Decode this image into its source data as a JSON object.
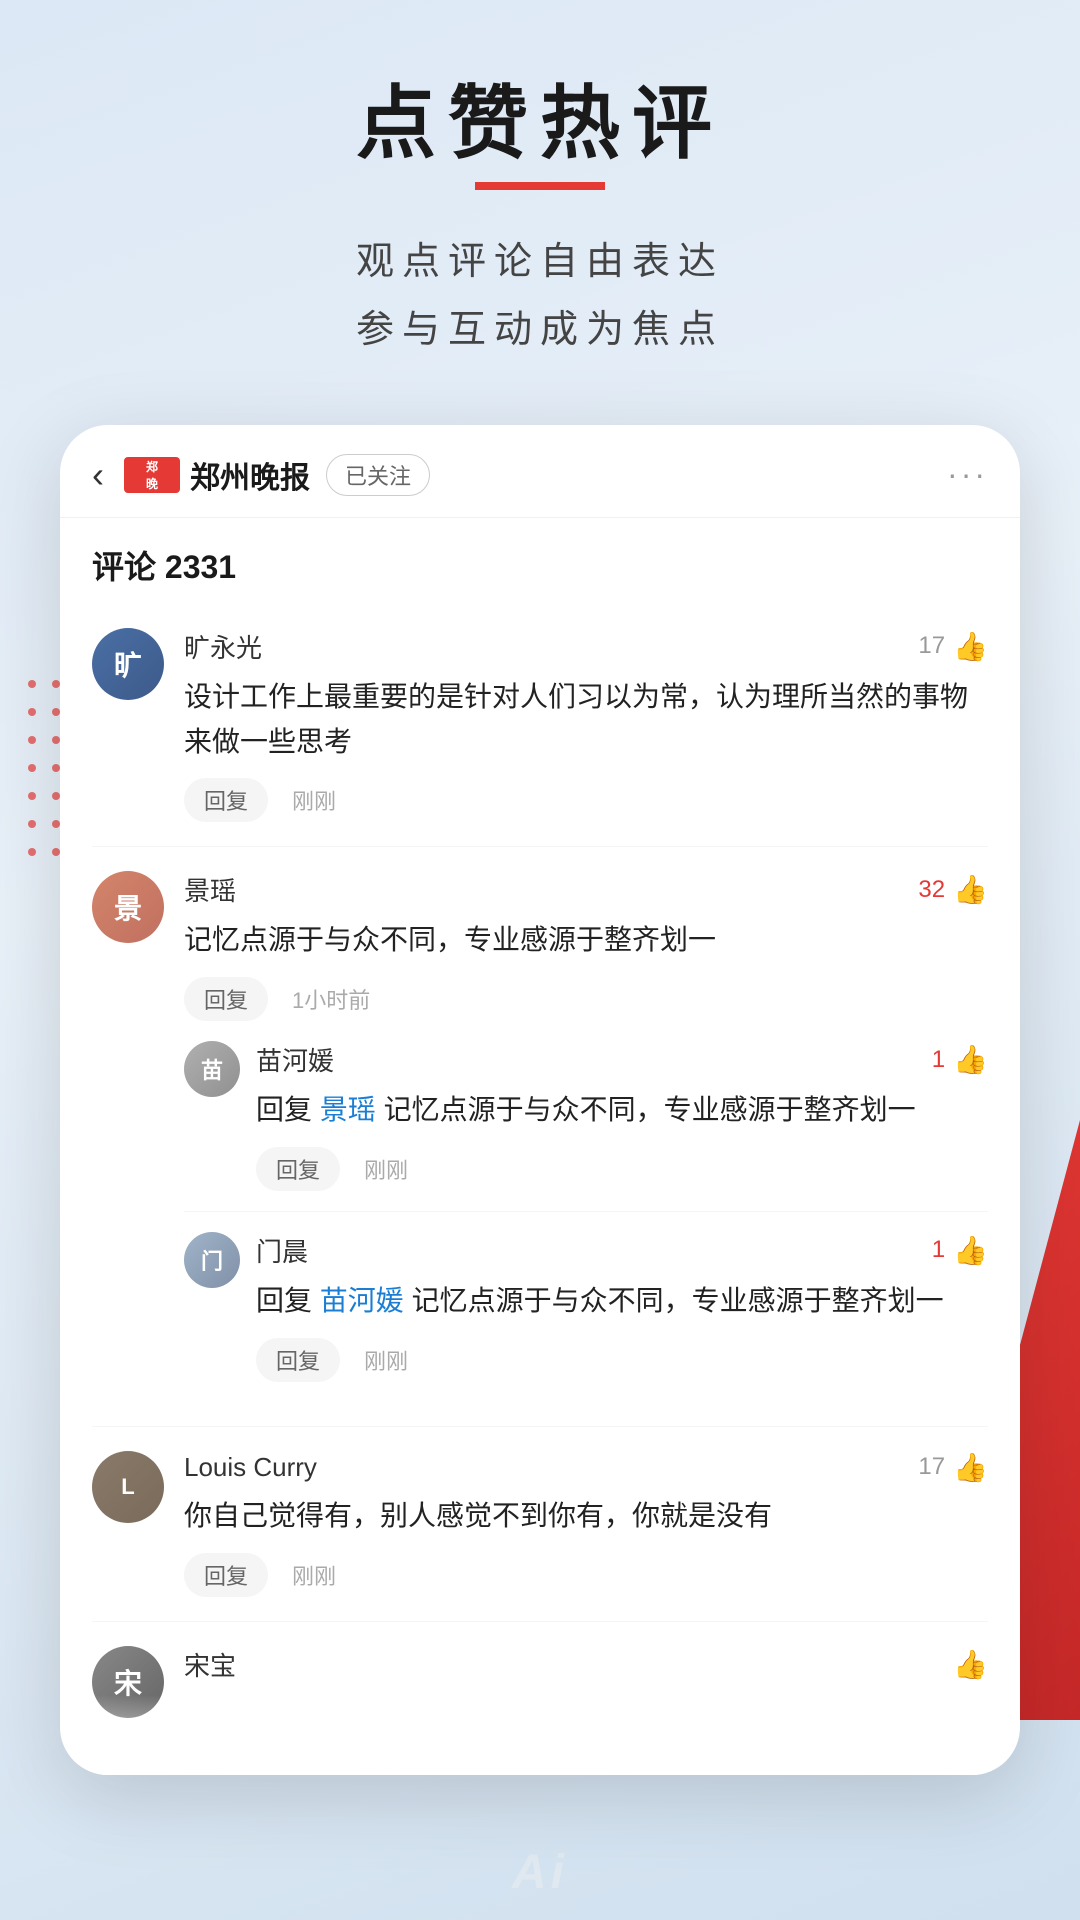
{
  "page": {
    "background": "#dce8f5",
    "ai_label": "Ai"
  },
  "header": {
    "main_title": "点赞热评",
    "subtitle_line1": "观点评论自由表达",
    "subtitle_line2": "参与互动成为焦点"
  },
  "app": {
    "back_label": "‹",
    "account_logo": "郑晚",
    "account_name": "郑州晚报",
    "follow_label": "已关注",
    "more_label": "···",
    "comment_count_label": "评论 2331"
  },
  "comments": [
    {
      "id": "c1",
      "username": "旷永光",
      "avatar_initials": "旷",
      "avatar_class": "avatar-kuang",
      "text": "设计工作上最重要的是针对人们习以为常，认为理所当然的事物来做一些思考",
      "like_count": "17",
      "like_active": false,
      "reply_label": "回复",
      "time": "刚刚",
      "replies": []
    },
    {
      "id": "c2",
      "username": "景瑶",
      "avatar_initials": "景",
      "avatar_class": "avatar-jing",
      "text": "记忆点源于与众不同，专业感源于整齐划一",
      "like_count": "32",
      "like_active": true,
      "reply_label": "回复",
      "time": "1小时前",
      "replies": [
        {
          "id": "r1",
          "username": "苗河媛",
          "avatar_initials": "苗",
          "avatar_class": "avatar-miao",
          "mention": "景瑶",
          "text": "记忆点源于与众不同，专业感源于整齐划一",
          "like_count": "1",
          "like_active": true,
          "reply_label": "回复",
          "time": "刚刚"
        },
        {
          "id": "r2",
          "username": "门晨",
          "avatar_initials": "门",
          "avatar_class": "avatar-men",
          "mention": "苗河媛",
          "text": "记忆点源于与众不同，专业感源于整齐划一",
          "like_count": "1",
          "like_active": true,
          "reply_label": "回复",
          "time": "刚刚"
        }
      ]
    },
    {
      "id": "c3",
      "username": "Louis Curry",
      "avatar_initials": "L",
      "avatar_class": "avatar-louis",
      "text": "你自己觉得有，别人感觉不到你有，你就是没有",
      "like_count": "17",
      "like_active": false,
      "reply_label": "回复",
      "time": "刚刚",
      "replies": []
    }
  ]
}
